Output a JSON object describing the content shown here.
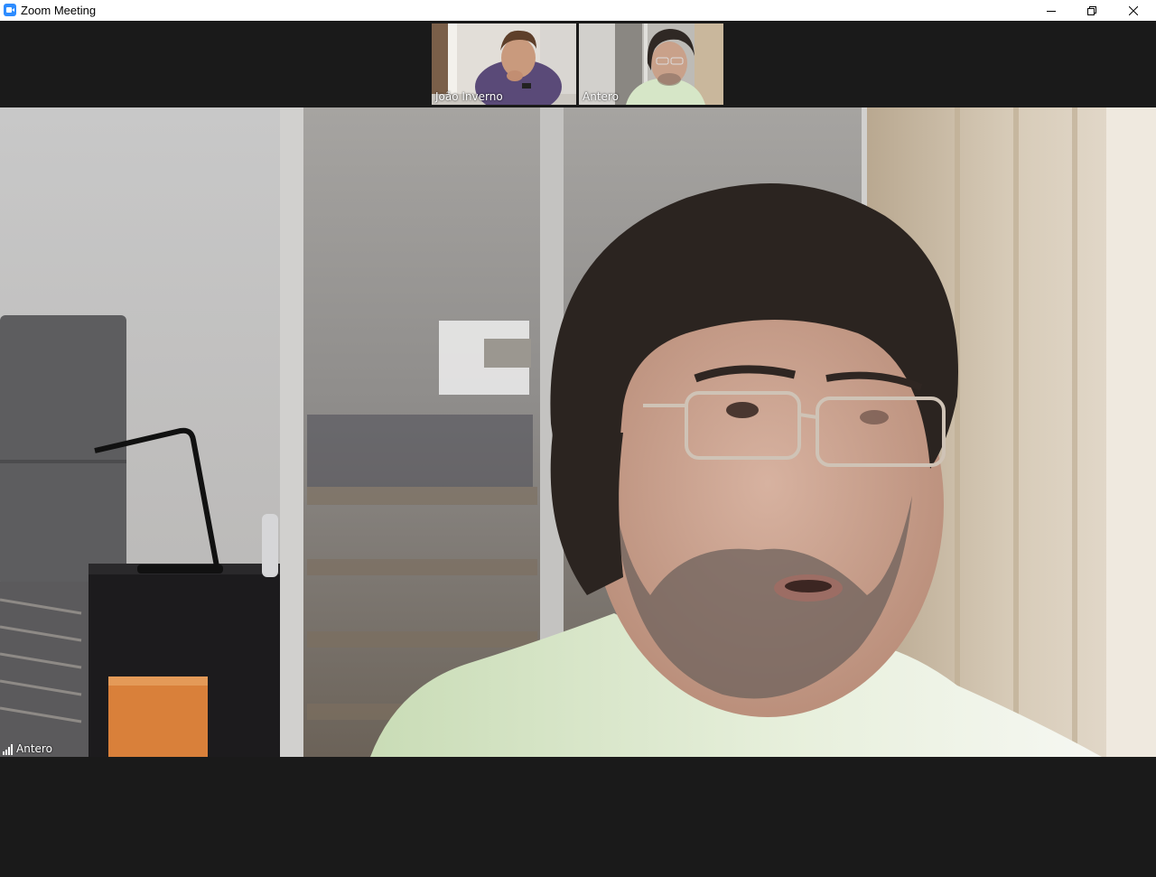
{
  "window": {
    "title": "Zoom Meeting",
    "icon": "zoom-camera-icon",
    "controls": [
      "minimize-icon",
      "restore-icon",
      "close-icon"
    ]
  },
  "thumbnails": [
    {
      "name": "João Inverno"
    },
    {
      "name": "Antero"
    }
  ],
  "main_video": {
    "speaker_name": "Antero",
    "status_icon": "signal-strength-icon"
  },
  "colors": {
    "background": "#1a1a1a",
    "titlebar": "#ffffff",
    "zoom_blue": "#2d8cff"
  }
}
